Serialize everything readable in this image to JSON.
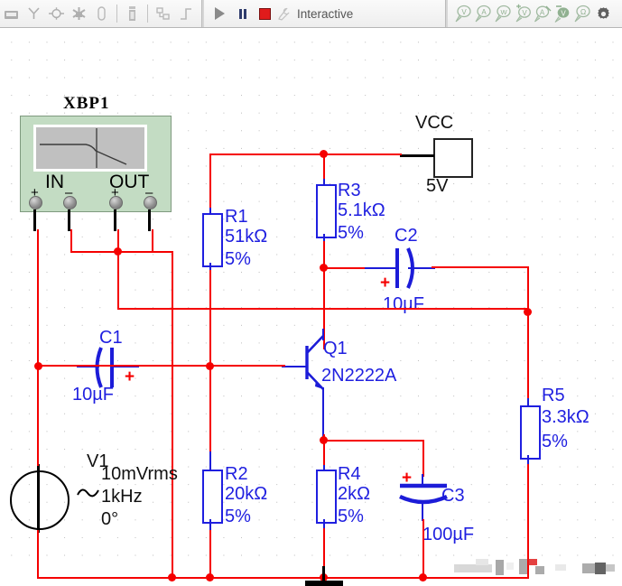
{
  "toolbar": {
    "left_icons": [
      {
        "name": "place-component-icon",
        "glyph": "▄"
      },
      {
        "name": "place-junction-icon",
        "glyph": "Y"
      },
      {
        "name": "place-bus-icon",
        "glyph": "⊕"
      },
      {
        "name": "place-connector-icon",
        "glyph": "✹"
      },
      {
        "name": "place-comment-icon",
        "glyph": "◗"
      }
    ],
    "mid_icons": [
      {
        "name": "graphs-icon",
        "glyph": "▮"
      },
      {
        "name": "hierarchy-icon",
        "glyph": "⊡"
      },
      {
        "name": "analysis-icon",
        "glyph": "⌐"
      }
    ],
    "run_label": "Interactive",
    "run_button": "run-simulation-button",
    "pause_button": "pause-simulation-button",
    "stop_button": "stop-simulation-button",
    "probe_icons": [
      {
        "name": "voltage-probe-icon",
        "glyph": "V"
      },
      {
        "name": "current-probe-icon",
        "glyph": "A"
      },
      {
        "name": "power-probe-icon",
        "glyph": "W"
      },
      {
        "name": "differential-voltage-probe-icon",
        "glyph": "V"
      },
      {
        "name": "differential-current-probe-icon",
        "glyph": "A"
      },
      {
        "name": "reference-voltage-probe-icon",
        "glyph": "V"
      },
      {
        "name": "frequency-probe-icon",
        "glyph": "Ω"
      }
    ],
    "settings_icon": "probe-settings-gear-icon"
  },
  "instrument": {
    "ref": "XBP1",
    "type": "bode-plotter",
    "in_label": "IN",
    "out_label": "OUT",
    "terminals": [
      "+",
      "–",
      "+",
      "–"
    ]
  },
  "power": {
    "ref": "VCC",
    "value": "5V"
  },
  "components": [
    {
      "ref": "R1",
      "value": "51kΩ",
      "tol": "5%",
      "kind": "resistor"
    },
    {
      "ref": "R2",
      "value": "20kΩ",
      "tol": "5%",
      "kind": "resistor"
    },
    {
      "ref": "R3",
      "value": "5.1kΩ",
      "tol": "5%",
      "kind": "resistor"
    },
    {
      "ref": "R4",
      "value": "2kΩ",
      "tol": "5%",
      "kind": "resistor"
    },
    {
      "ref": "R5",
      "value": "3.3kΩ",
      "tol": "5%",
      "kind": "resistor"
    },
    {
      "ref": "C1",
      "value": "10µF",
      "kind": "capacitor-polarized",
      "polarity": "+"
    },
    {
      "ref": "C2",
      "value": "10µF",
      "kind": "capacitor-polarized",
      "polarity": "+"
    },
    {
      "ref": "C3",
      "value": "100µF",
      "kind": "capacitor-polarized",
      "polarity": "+"
    },
    {
      "ref": "Q1",
      "value": "2N2222A",
      "kind": "npn-transistor"
    },
    {
      "ref": "V1",
      "value": "10mVrms",
      "freq": "1kHz",
      "phase": "0°",
      "kind": "ac-voltage-source"
    }
  ],
  "labels": {
    "r1_ref": "R1",
    "r1_val": "51kΩ",
    "r1_tol": "5%",
    "r2_ref": "R2",
    "r2_val": "20kΩ",
    "r2_tol": "5%",
    "r3_ref": "R3",
    "r3_val": "5.1kΩ",
    "r3_tol": "5%",
    "r4_ref": "R4",
    "r4_val": "2kΩ",
    "r4_tol": "5%",
    "r5_ref": "R5",
    "r5_val": "3.3kΩ",
    "r5_tol": "5%",
    "c1_ref": "C1",
    "c1_val": "10µF",
    "c1_plus": "+",
    "c2_ref": "C2",
    "c2_val": "10µF",
    "c2_plus": "+",
    "c3_ref": "C3",
    "c3_val": "100µF",
    "c3_plus": "+",
    "q1_ref": "Q1",
    "q1_val": "2N2222A",
    "v1_ref": "V1",
    "v1_val": "10mVrms",
    "v1_freq": "1kHz",
    "v1_phase": "0°",
    "vcc_ref": "VCC",
    "vcc_val": "5V",
    "xbp_ref": "XBP1",
    "xbp_in": "IN",
    "xbp_out": "OUT",
    "sign_plus": "+",
    "sign_minus": "–"
  },
  "colors": {
    "wire": "#f50000",
    "component": "#1f1fe0",
    "black_wire": "#000000",
    "instrument_body": "#c3dcc3",
    "instrument_screen": "#c0c0c0",
    "toolbar_bg": "#eeeeee",
    "probe_green": "#3f7a3f"
  }
}
